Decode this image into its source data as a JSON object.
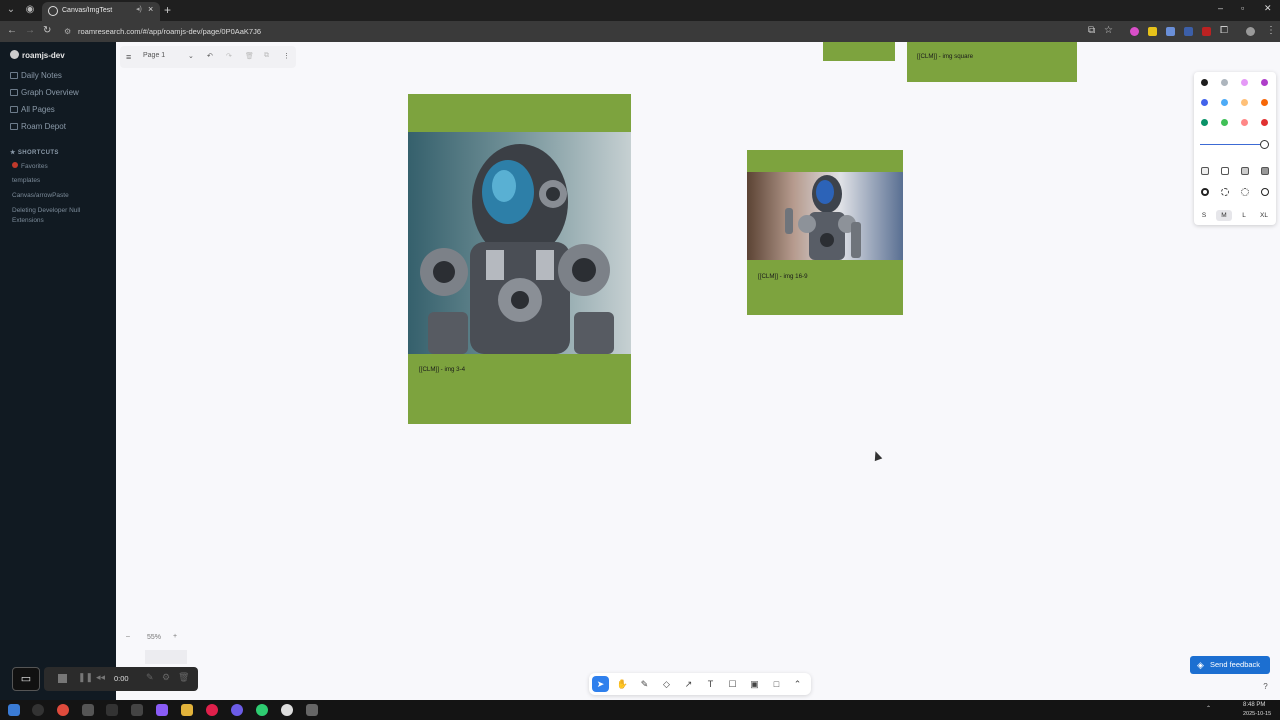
{
  "browser": {
    "tab_title": "Canvas/ImgTest",
    "new_tab": "+",
    "url": "roamresearch.com/#/app/roamjs-dev/page/0P0AaK7J6",
    "window_controls": [
      "–",
      "▫",
      "✕"
    ]
  },
  "sidebar": {
    "graph_name": "roamjs-dev",
    "nav": [
      {
        "label": "Daily Notes",
        "icon": "calendar-icon"
      },
      {
        "label": "Graph Overview",
        "icon": "graph-icon"
      },
      {
        "label": "All Pages",
        "icon": "list-icon"
      },
      {
        "label": "Roam Depot",
        "icon": "store-icon"
      }
    ],
    "shortcuts_header": "SHORTCUTS",
    "shortcuts": [
      "Favorites",
      "templates",
      "Canvas/arrowPaste",
      "Deleting Developer Null Extensions"
    ]
  },
  "canvas": {
    "page_menu_label": "Page 1",
    "cards": [
      {
        "caption": "[[CLM]] - img square"
      },
      {
        "caption": "[[CLM]] - img 3-4"
      },
      {
        "caption": "[[CLM]] - img 16-9"
      }
    ],
    "zoom": "55%",
    "zoom_out": "–",
    "zoom_in": "+"
  },
  "style_panel": {
    "colors": [
      "#1d1d1d",
      "#adb5bd",
      "#e599f7",
      "#ae3ec9",
      "#4263eb",
      "#4dabf7",
      "#ffc078",
      "#f76707",
      "#099268",
      "#40c057",
      "#ff8787",
      "#e03131"
    ],
    "sizes": [
      "S",
      "M",
      "L",
      "XL"
    ],
    "selected_size": "M"
  },
  "toolbar": {
    "tools": [
      {
        "name": "select-tool",
        "glyph": "➤"
      },
      {
        "name": "hand-tool",
        "glyph": "✋"
      },
      {
        "name": "draw-tool",
        "glyph": "✎"
      },
      {
        "name": "eraser-tool",
        "glyph": "◇"
      },
      {
        "name": "arrow-tool",
        "glyph": "↗"
      },
      {
        "name": "text-tool",
        "glyph": "T"
      },
      {
        "name": "note-tool",
        "glyph": "☐"
      },
      {
        "name": "asset-tool",
        "glyph": "▣"
      },
      {
        "name": "rectangle-tool",
        "glyph": "□"
      },
      {
        "name": "more-tool",
        "glyph": "⌃"
      }
    ]
  },
  "recorder": {
    "time": "0:00"
  },
  "feedback_label": "Send feedback",
  "help": "?",
  "taskbar": {
    "time": "8:48 PM",
    "date": "2025-10-15"
  }
}
